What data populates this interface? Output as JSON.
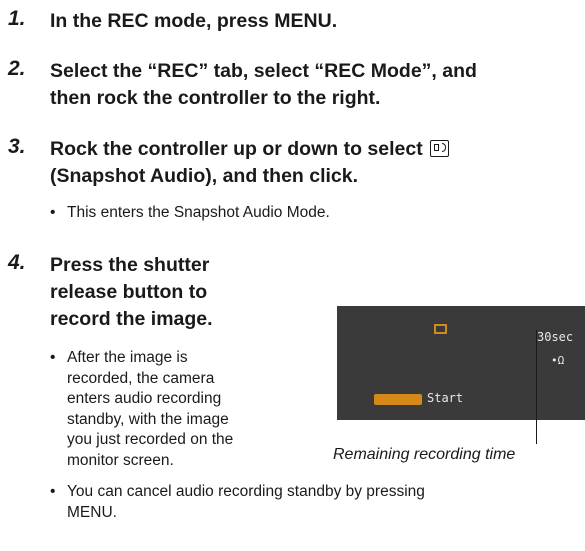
{
  "steps": [
    {
      "num": "1.",
      "text": "In the REC mode, press MENU."
    },
    {
      "num": "2.",
      "line1": "Select the “REC” tab, select “REC Mode”, and",
      "line2": "then rock the controller to the right."
    },
    {
      "num": "3.",
      "line1a": "Rock the controller up or down to select",
      "line2": "(Snapshot Audio), and then click.",
      "icon": "snapshot-audio-icon"
    },
    {
      "num": "4.",
      "line1": "Press the shutter",
      "line2": "release button to",
      "line3": "record the image."
    }
  ],
  "bullets": {
    "b1": "This enters the Snapshot Audio Mode.",
    "b2": [
      "After the image is",
      "recorded, the camera",
      "enters audio recording",
      "standby, with the image",
      "you just recorded on the",
      "monitor screen."
    ],
    "b3": [
      "You can cancel audio recording standby by pressing",
      "MENU."
    ],
    "dot": "•"
  },
  "screen": {
    "time": "30sec",
    "start": "Start",
    "mic": "•Ω"
  },
  "caption": "Remaining recording time"
}
